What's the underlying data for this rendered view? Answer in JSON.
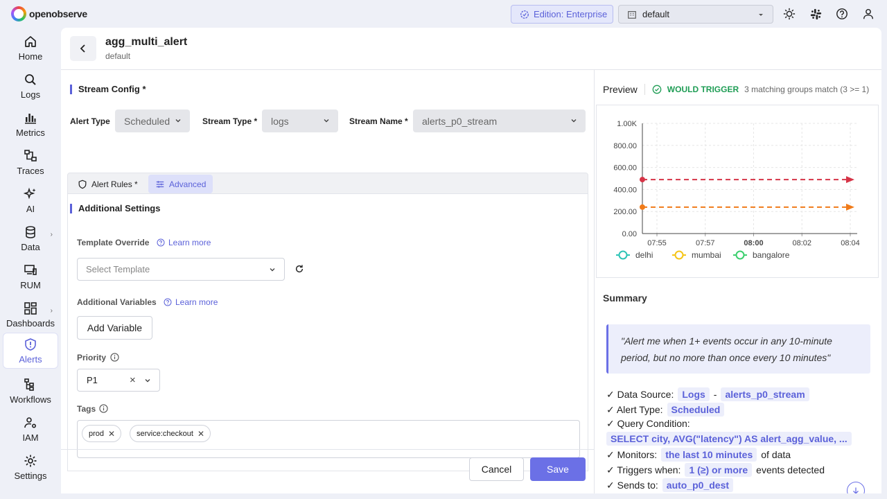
{
  "app": {
    "name": "openobserve",
    "edition": "Edition: Enterprise",
    "org": "default"
  },
  "nav": [
    {
      "label": "Home",
      "icon": "home-icon"
    },
    {
      "label": "Logs",
      "icon": "search-icon"
    },
    {
      "label": "Metrics",
      "icon": "bar-chart-icon"
    },
    {
      "label": "Traces",
      "icon": "traces-icon"
    },
    {
      "label": "AI",
      "icon": "sparkle-icon"
    },
    {
      "label": "Data",
      "icon": "database-icon"
    },
    {
      "label": "RUM",
      "icon": "devices-icon"
    },
    {
      "label": "Dashboards",
      "icon": "dashboard-icon"
    },
    {
      "label": "Alerts",
      "icon": "alert-icon"
    },
    {
      "label": "Workflows",
      "icon": "workflow-icon"
    },
    {
      "label": "IAM",
      "icon": "user-gear-icon"
    },
    {
      "label": "Settings",
      "icon": "gear-icon"
    }
  ],
  "header": {
    "title": "agg_multi_alert",
    "subtitle": "default"
  },
  "stream_config": {
    "title": "Stream Config *",
    "alert_type_label": "Alert Type",
    "alert_type_value": "Scheduled",
    "stream_type_label": "Stream Type *",
    "stream_type_value": "logs",
    "stream_name_label": "Stream Name *",
    "stream_name_value": "alerts_p0_stream"
  },
  "rules": {
    "alert_rules_label": "Alert Rules *",
    "advanced_label": "Advanced"
  },
  "additional": {
    "title": "Additional Settings",
    "template_override_label": "Template Override",
    "learn_more": "Learn more",
    "template_placeholder": "Select Template",
    "additional_variables_label": "Additional Variables",
    "add_variable_label": "Add Variable",
    "priority_label": "Priority",
    "priority_value": "P1",
    "tags_label": "Tags",
    "tags": [
      "prod",
      "service:checkout"
    ]
  },
  "footer": {
    "cancel_label": "Cancel",
    "save_label": "Save"
  },
  "preview": {
    "title": "Preview",
    "status": "WOULD TRIGGER",
    "status_desc": "3 matching groups match (3 >= 1)"
  },
  "chart_data": {
    "type": "line",
    "x": [
      "07:55",
      "07:57",
      "08:00",
      "08:02",
      "08:04"
    ],
    "y_ticks": [
      "1.00K",
      "800.00",
      "600.00",
      "400.00",
      "200.00",
      "0.00"
    ],
    "ylim": [
      0,
      1000
    ],
    "legend": [
      "delhi",
      "mumbai",
      "bangalore"
    ],
    "series": [
      {
        "values": [
          490,
          490
        ],
        "color": "#d63447"
      },
      {
        "values": [
          240,
          240
        ],
        "color": "#f07b1a"
      }
    ],
    "legend_colors": [
      "#2ec4b6",
      "#f5c518",
      "#3ccf6e"
    ]
  },
  "summary": {
    "title": "Summary",
    "quote": "\"Alert me when 1+ events occur in any 10-minute period, but no more than once every 10 minutes\"",
    "data_source_label": "✓ Data Source:",
    "data_source_type": "Logs",
    "data_source_sep": "-",
    "data_source_stream": "alerts_p0_stream",
    "alert_type_label": "✓ Alert Type:",
    "alert_type_value": "Scheduled",
    "query_label": "✓ Query Condition:",
    "query_value": "SELECT city, AVG(\"latency\") AS alert_agg_value, ...",
    "monitors_label": "✓ Monitors:",
    "monitors_value": "the last 10 minutes",
    "monitors_suffix": "of data",
    "triggers_label": "✓ Triggers when:",
    "triggers_value": "1 (≥) or more",
    "triggers_suffix": "events detected",
    "sends_label": "✓ Sends to:",
    "sends_value": "auto_p0_dest"
  }
}
